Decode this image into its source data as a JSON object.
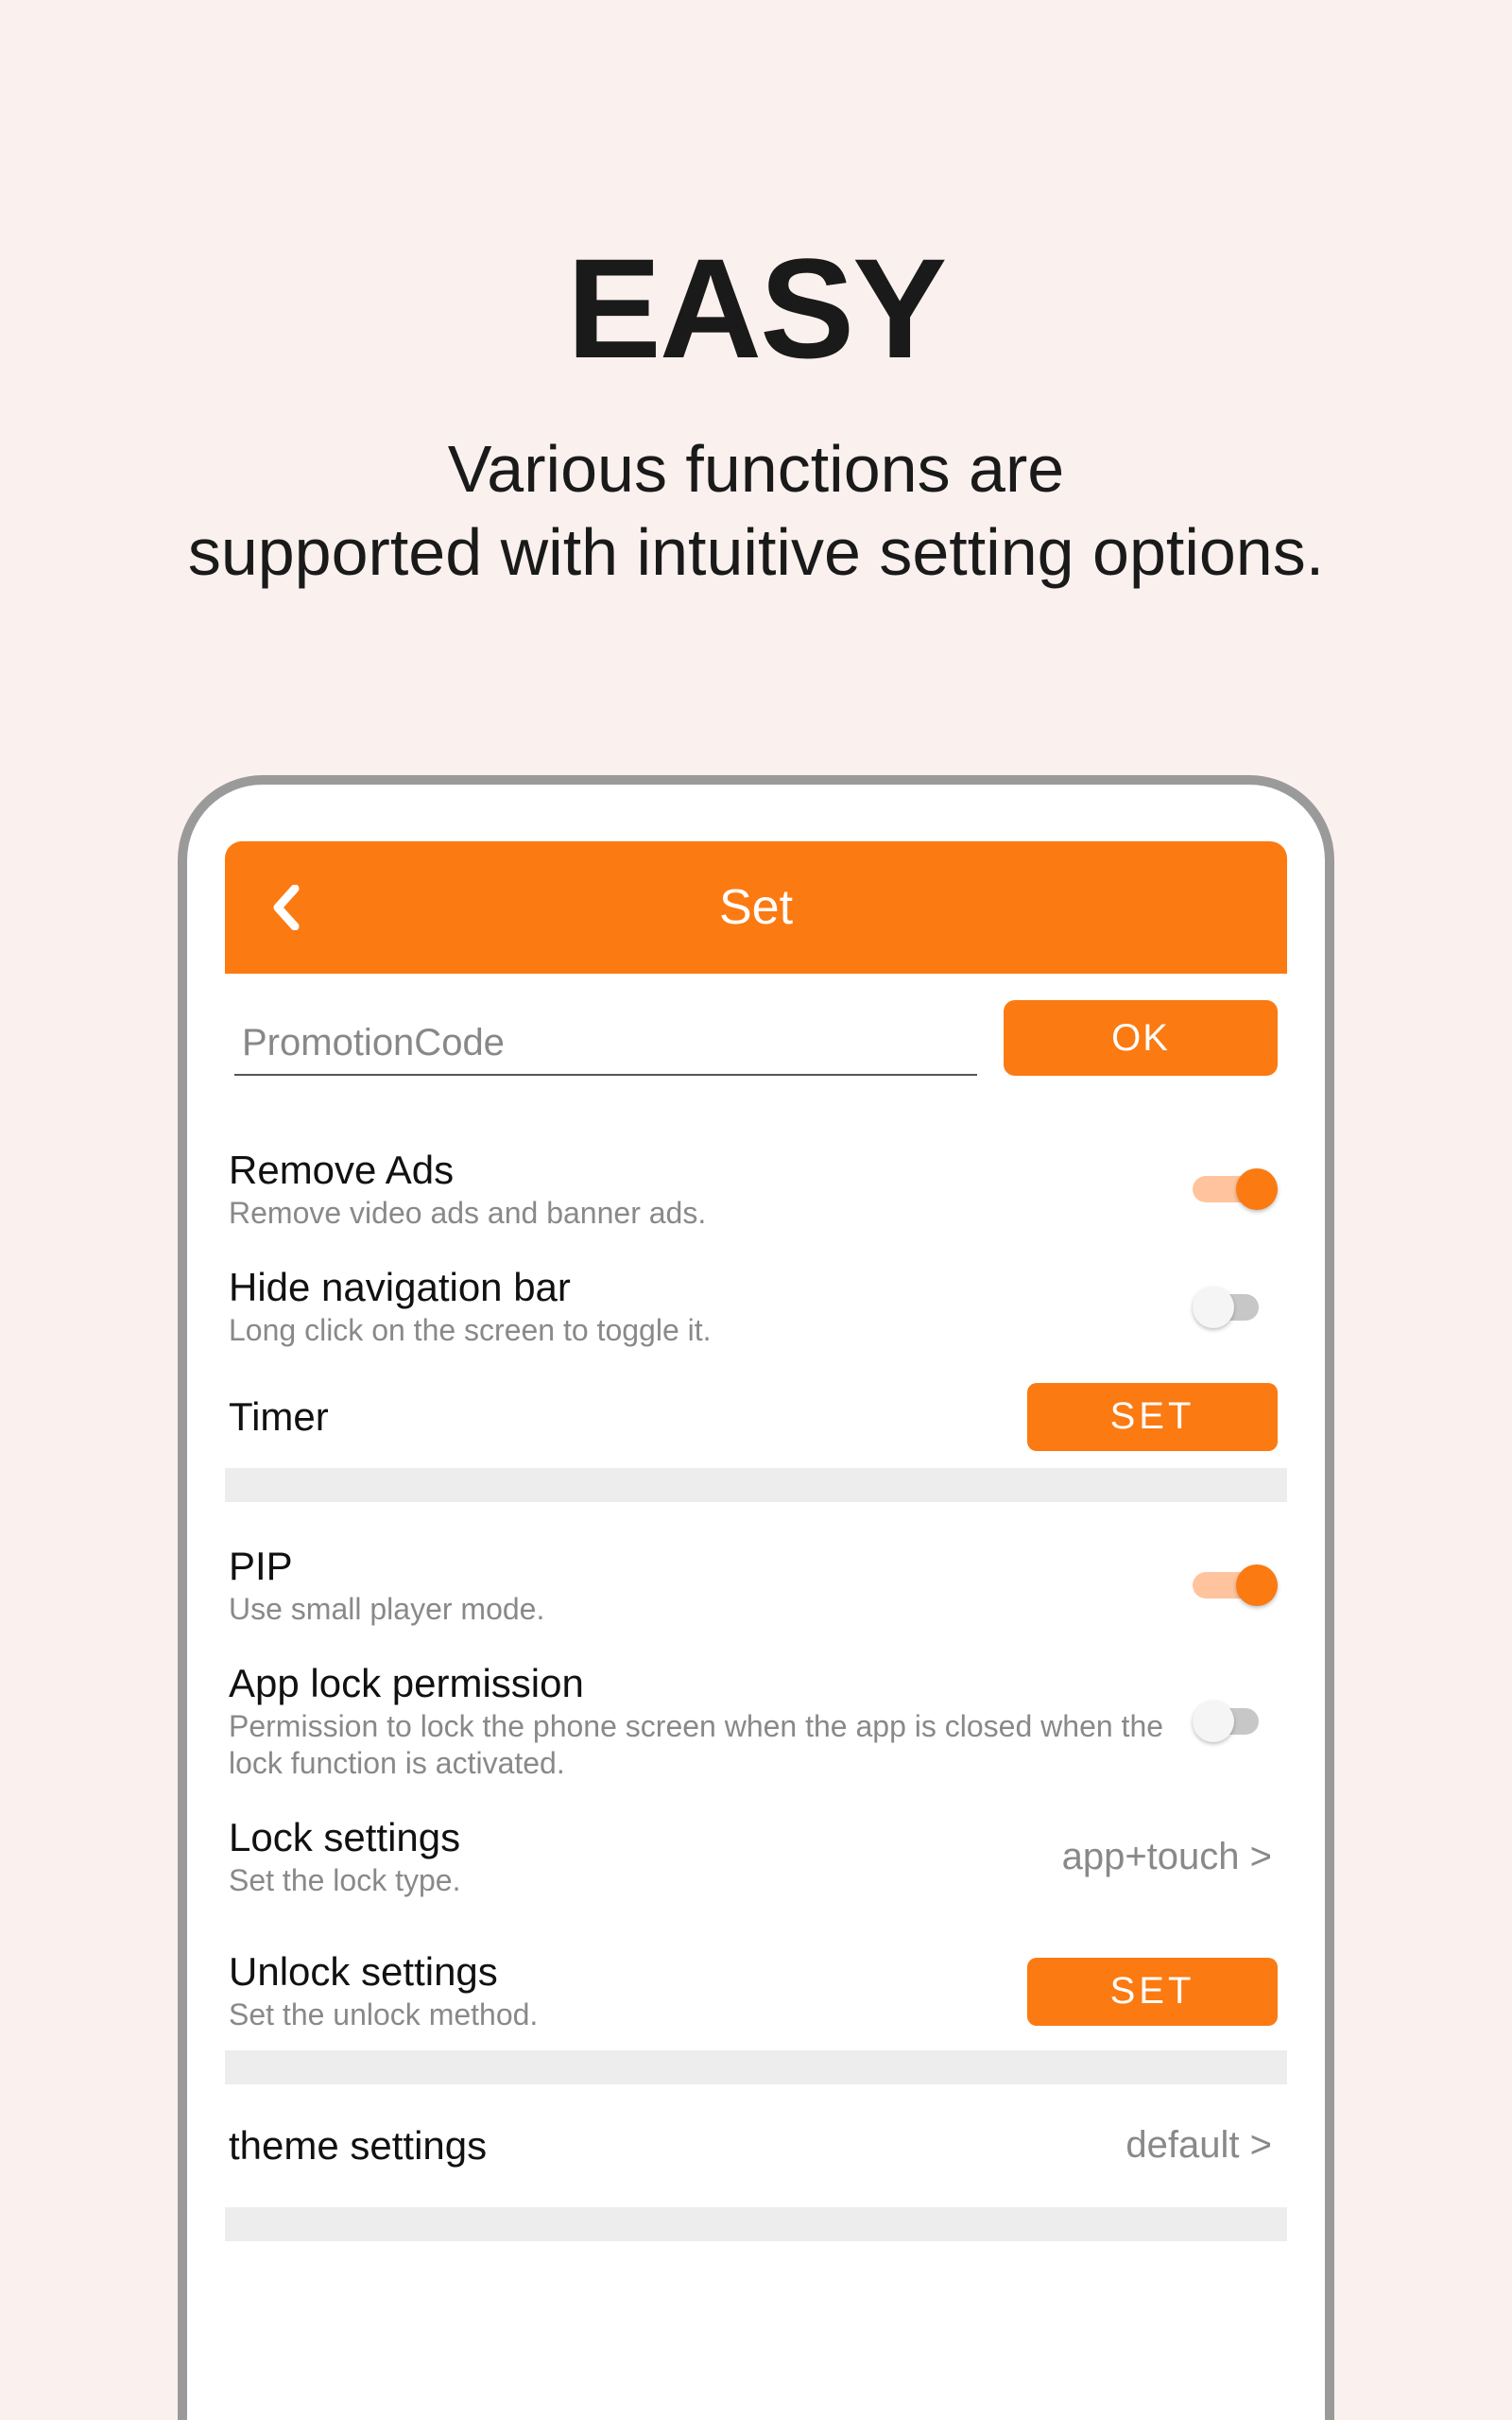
{
  "hero": {
    "title": "EASY",
    "subtitle_line1": "Various functions are",
    "subtitle_line2": "supported with intuitive setting options."
  },
  "app": {
    "header_title": "Set",
    "promo": {
      "placeholder": "PromotionCode",
      "ok_label": "OK"
    },
    "rows": {
      "remove_ads": {
        "title": "Remove Ads",
        "sub": "Remove video ads and banner ads.",
        "toggled": true
      },
      "hide_nav": {
        "title": "Hide navigation bar",
        "sub": "Long click on the screen to toggle it.",
        "toggled": false
      },
      "timer": {
        "title": "Timer",
        "button_label": "SET"
      },
      "pip": {
        "title": "PIP",
        "sub": "Use small player mode.",
        "toggled": true
      },
      "app_lock": {
        "title": "App lock permission",
        "sub": "Permission to lock the phone screen when the app is closed when the lock function is activated.",
        "toggled": false
      },
      "lock_set": {
        "title": "Lock settings",
        "sub": "Set the lock type.",
        "value": "app+touch >"
      },
      "unlock_set": {
        "title": "Unlock settings",
        "sub": "Set the unlock method.",
        "button_label": "SET"
      },
      "theme": {
        "title": "theme settings",
        "value": "default >"
      }
    }
  },
  "colors": {
    "accent": "#fb7a12"
  }
}
